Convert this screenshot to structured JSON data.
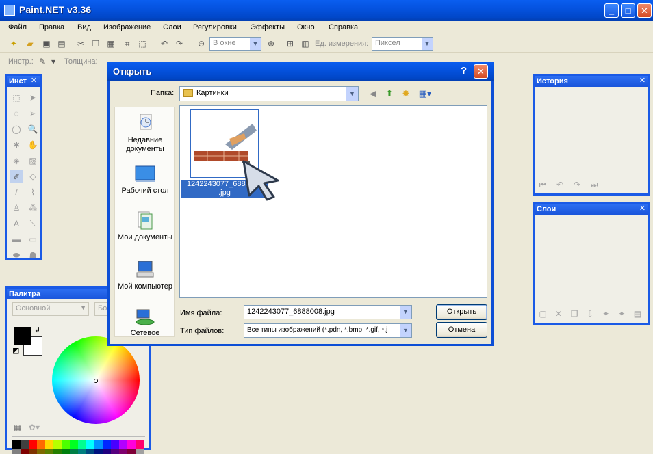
{
  "app": {
    "title": "Paint.NET v3.36"
  },
  "menu": [
    "Файл",
    "Правка",
    "Вид",
    "Изображение",
    "Слои",
    "Регулировки",
    "Эффекты",
    "Окно",
    "Справка"
  ],
  "toolbar1": {
    "zoom_value": "В окне",
    "units_label": "Ед. измерения:",
    "units_value": "Пиксел"
  },
  "toolbar2": {
    "tool_label": "Инстр.:",
    "width_label": "Толщина:"
  },
  "panels": {
    "tools_title": "Инст",
    "palette_title": "Палитра",
    "palette_mode": "Основной",
    "palette_more": "Бо",
    "history_title": "История",
    "layers_title": "Слои"
  },
  "dialog": {
    "title": "Открыть",
    "help": "?",
    "look_in_label": "Папка:",
    "look_in_value": "Картинки",
    "places": [
      {
        "label": "Недавние документы"
      },
      {
        "label": "Рабочий стол"
      },
      {
        "label": "Мои документы"
      },
      {
        "label": "Мой компьютер"
      },
      {
        "label": "Сетевое"
      }
    ],
    "file": {
      "name_line1": "1242243077_6888008",
      "name_line2": ".jpg"
    },
    "file_name_label": "Имя файла:",
    "file_name_value": "1242243077_6888008.jpg",
    "file_type_label": "Тип файлов:",
    "file_type_value": "Все типы изображений (*.pdn, *.bmp, *.gif, *.j",
    "open_button": "Открыть",
    "cancel_button": "Отмена"
  },
  "colors": {
    "primary": "#000000",
    "secondary": "#ffffff",
    "palette": [
      "#000000",
      "#404040",
      "#ff0000",
      "#ff6a00",
      "#ffd800",
      "#b6ff00",
      "#4cff00",
      "#00ff21",
      "#00ff90",
      "#00ffff",
      "#0094ff",
      "#0026ff",
      "#4800ff",
      "#b200ff",
      "#ff00dc",
      "#ff006e",
      "#808080",
      "#7f0000",
      "#7f3300",
      "#7f6a00",
      "#5b7f00",
      "#267f00",
      "#007f0e",
      "#007f46",
      "#007f7f",
      "#004a7f",
      "#00137f",
      "#21007f",
      "#57007f",
      "#7f006e",
      "#7f0037",
      "#a0a0a0"
    ]
  }
}
